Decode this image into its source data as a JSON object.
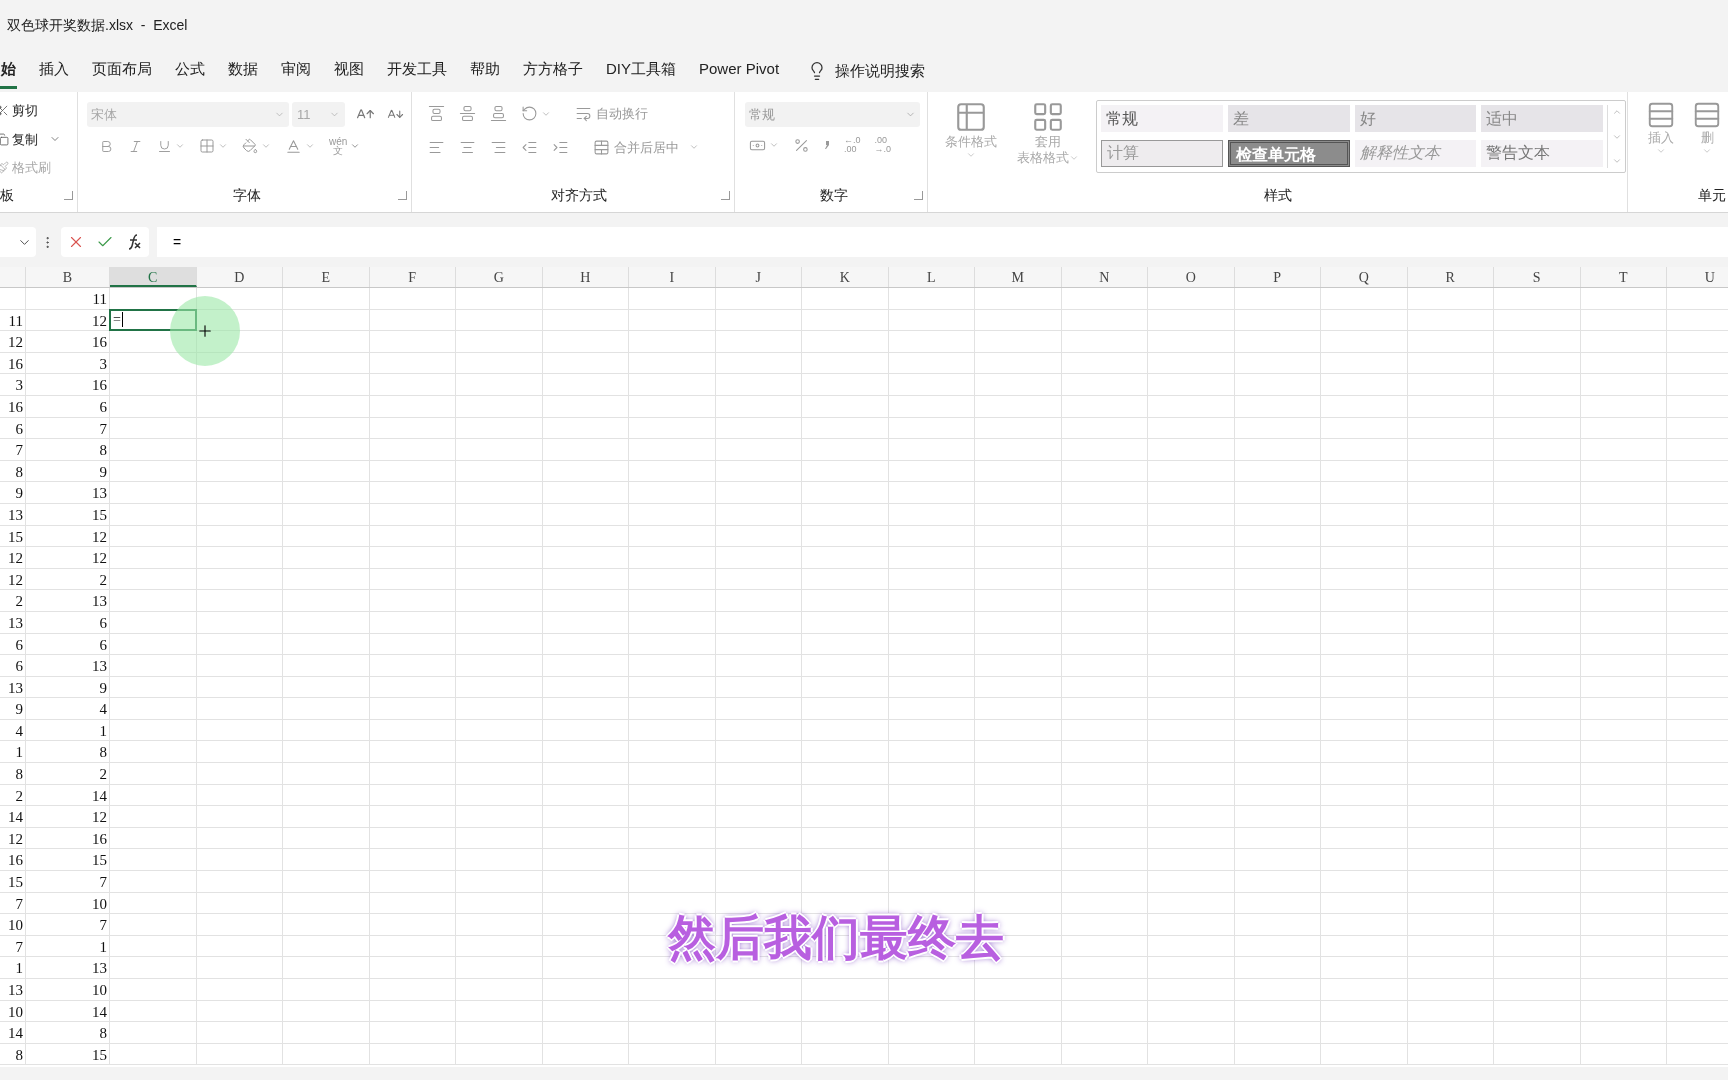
{
  "title_bar": {
    "title": "双色球开奖数据.xlsx  -  Excel"
  },
  "tabs": [
    {
      "label": "始",
      "selected": true
    },
    {
      "label": "插入",
      "selected": false
    },
    {
      "label": "页面布局",
      "selected": false
    },
    {
      "label": "公式",
      "selected": false
    },
    {
      "label": "数据",
      "selected": false
    },
    {
      "label": "审阅",
      "selected": false
    },
    {
      "label": "视图",
      "selected": false
    },
    {
      "label": "开发工具",
      "selected": false
    },
    {
      "label": "帮助",
      "selected": false
    },
    {
      "label": "方方格子",
      "selected": false
    },
    {
      "label": "DIY工具箱",
      "selected": false
    },
    {
      "label": "Power Pivot",
      "selected": false
    }
  ],
  "tell_me": "操作说明搜索",
  "ribbon": {
    "disabled": true,
    "clipboard": {
      "label": "板",
      "cut": "剪切",
      "copy": "复制",
      "format_painter": "格式刷"
    },
    "font": {
      "label": "字体",
      "font_name": "宋体",
      "font_size": "11",
      "phonetic_top": "wén",
      "phonetic_bottom": "文"
    },
    "alignment": {
      "label": "对齐方式",
      "wrap_text": "自动换行",
      "merge_center": "合并后居中"
    },
    "number": {
      "label": "数字",
      "format": "常规",
      "increase_decimal": [
        "←.0",
        ".00"
      ],
      "decrease_decimal": [
        ".00",
        "→.0"
      ]
    },
    "styles": {
      "label": "样式",
      "conditional_formatting": "条件格式",
      "format_as_table": [
        "套用",
        "表格格式"
      ],
      "cell_styles": [
        {
          "label": "常规",
          "kind": "normal"
        },
        {
          "label": "差",
          "kind": "bad"
        },
        {
          "label": "好",
          "kind": "good"
        },
        {
          "label": "适中",
          "kind": "neutral"
        },
        {
          "label": "计算",
          "kind": "calculation"
        },
        {
          "label": "检查单元格",
          "kind": "check"
        },
        {
          "label": "解释性文本",
          "kind": "explanatory"
        },
        {
          "label": "警告文本",
          "kind": "warning"
        }
      ]
    },
    "cells": {
      "label": "单元",
      "insert": "插入",
      "delete": "删"
    }
  },
  "formula_bar": {
    "formula": "="
  },
  "sheet": {
    "columns": [
      {
        "label": "B",
        "selected": false
      },
      {
        "label": "C",
        "selected": true
      },
      {
        "label": "D",
        "selected": false
      },
      {
        "label": "E",
        "selected": false
      },
      {
        "label": "F",
        "selected": false
      },
      {
        "label": "G",
        "selected": false
      },
      {
        "label": "H",
        "selected": false
      },
      {
        "label": "I",
        "selected": false
      },
      {
        "label": "J",
        "selected": false
      },
      {
        "label": "K",
        "selected": false
      },
      {
        "label": "L",
        "selected": false
      },
      {
        "label": "M",
        "selected": false
      },
      {
        "label": "N",
        "selected": false
      },
      {
        "label": "O",
        "selected": false
      },
      {
        "label": "P",
        "selected": false
      },
      {
        "label": "Q",
        "selected": false
      },
      {
        "label": "R",
        "selected": false
      },
      {
        "label": "S",
        "selected": false
      },
      {
        "label": "T",
        "selected": false
      },
      {
        "label": "U",
        "selected": false
      }
    ],
    "active_cell": {
      "value": "="
    },
    "rows": [
      {
        "cells": [
          null,
          "11"
        ],
        "active": false
      },
      {
        "cells": [
          "11",
          "12"
        ],
        "active": true
      },
      {
        "cells": [
          "12",
          "16"
        ],
        "active": false
      },
      {
        "cells": [
          "16",
          "3"
        ],
        "active": false
      },
      {
        "cells": [
          "3",
          "16"
        ],
        "active": false
      },
      {
        "cells": [
          "16",
          "6"
        ],
        "active": false
      },
      {
        "cells": [
          "6",
          "7"
        ],
        "active": false
      },
      {
        "cells": [
          "7",
          "8"
        ],
        "active": false
      },
      {
        "cells": [
          "8",
          "9"
        ],
        "active": false
      },
      {
        "cells": [
          "9",
          "13"
        ],
        "active": false
      },
      {
        "cells": [
          "13",
          "15"
        ],
        "active": false
      },
      {
        "cells": [
          "15",
          "12"
        ],
        "active": false
      },
      {
        "cells": [
          "12",
          "12"
        ],
        "active": false
      },
      {
        "cells": [
          "12",
          "2"
        ],
        "active": false
      },
      {
        "cells": [
          "2",
          "13"
        ],
        "active": false
      },
      {
        "cells": [
          "13",
          "6"
        ],
        "active": false
      },
      {
        "cells": [
          "6",
          "6"
        ],
        "active": false
      },
      {
        "cells": [
          "6",
          "13"
        ],
        "active": false
      },
      {
        "cells": [
          "13",
          "9"
        ],
        "active": false
      },
      {
        "cells": [
          "9",
          "4"
        ],
        "active": false
      },
      {
        "cells": [
          "4",
          "1"
        ],
        "active": false
      },
      {
        "cells": [
          "1",
          "8"
        ],
        "active": false
      },
      {
        "cells": [
          "8",
          "2"
        ],
        "active": false
      },
      {
        "cells": [
          "2",
          "14"
        ],
        "active": false
      },
      {
        "cells": [
          "14",
          "12"
        ],
        "active": false
      },
      {
        "cells": [
          "12",
          "16"
        ],
        "active": false
      },
      {
        "cells": [
          "16",
          "15"
        ],
        "active": false
      },
      {
        "cells": [
          "15",
          "7"
        ],
        "active": false
      },
      {
        "cells": [
          "7",
          "10"
        ],
        "active": false
      },
      {
        "cells": [
          "10",
          "7"
        ],
        "active": false
      },
      {
        "cells": [
          "7",
          "1"
        ],
        "active": false
      },
      {
        "cells": [
          "1",
          "13"
        ],
        "active": false
      },
      {
        "cells": [
          "13",
          "10"
        ],
        "active": false
      },
      {
        "cells": [
          "10",
          "14"
        ],
        "active": false
      },
      {
        "cells": [
          "14",
          "8"
        ],
        "active": false
      },
      {
        "cells": [
          "8",
          "15"
        ],
        "active": false
      }
    ]
  },
  "caption": "然后我们最终去"
}
